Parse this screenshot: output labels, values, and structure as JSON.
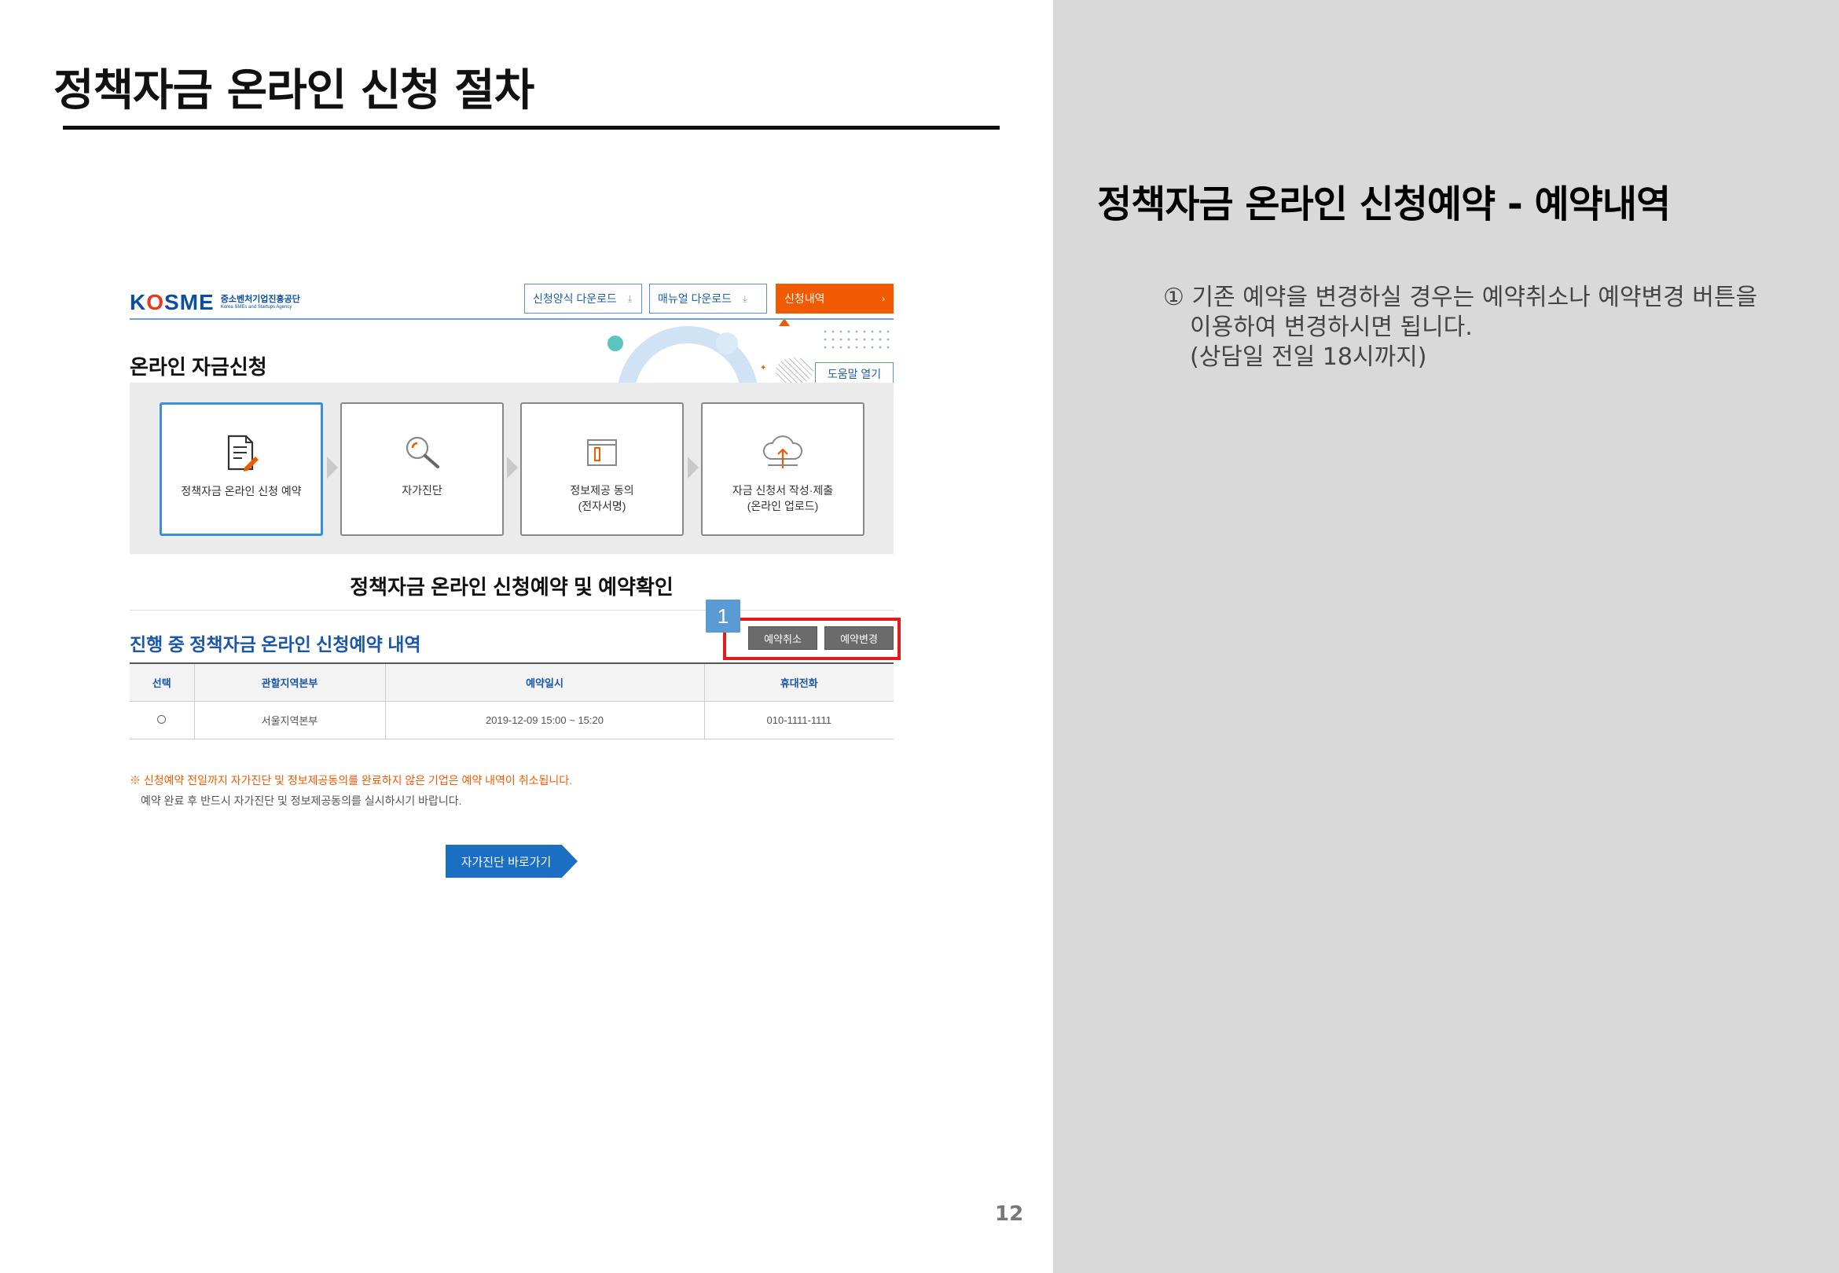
{
  "slide": {
    "title": "정책자금 온라인 신청 절차",
    "page_number": "12"
  },
  "right_panel": {
    "heading": "정책자금 온라인 신청예약 - 예약내역",
    "lines": [
      "① 기존 예약을 변경하실 경우는 예약취소나 예약변경 버튼을",
      "이용하여 변경하시면 됩니다.",
      "(상담일 전일 18시까지)"
    ]
  },
  "screenshot": {
    "logo": {
      "brand": "KOSME",
      "name_ko": "중소벤처기업진흥공단",
      "name_en": "Korea SMEs and Startups Agency"
    },
    "top_buttons": [
      {
        "label": "신청양식 다운로드",
        "icon": "download-icon"
      },
      {
        "label": "매뉴얼 다운로드",
        "icon": "download-icon"
      },
      {
        "label": "신청내역",
        "icon": "chevron-right-icon"
      }
    ],
    "page_title": "온라인 자금신청",
    "help_button": "도움말 열기",
    "steps": [
      {
        "label": "정책자금 온라인 신청 예약",
        "icon": "document-pen-icon",
        "active": true
      },
      {
        "label": "자가진단",
        "icon": "magnifier-icon",
        "active": false
      },
      {
        "label": "정보제공 동의\n(전자서명)",
        "icon": "folder-icon",
        "active": false
      },
      {
        "label": "자금 신청서 작성·제출\n(온라인 업로드)",
        "icon": "cloud-upload-icon",
        "active": false
      }
    ],
    "section_title": "정책자금 온라인 신청예약 및 예약확인",
    "list_title": "진행 중 정책자금 온라인 신청예약 내역",
    "annotation_number": "1",
    "actions": {
      "cancel": "예약취소",
      "change": "예약변경"
    },
    "table": {
      "headers": [
        "선택",
        "관할지역본부",
        "예약일시",
        "휴대전화"
      ],
      "rows": [
        {
          "region": "서울지역본부",
          "datetime": "2019-12-09 15:00 ~ 15:20",
          "phone": "010-1111-1111"
        }
      ]
    },
    "notice_1": "※ 신청예약 전일까지 자가진단 및 정보제공동의를 완료하지 않은 기업은 예약 내역이 취소됩니다.",
    "notice_2": "예약 완료 후 반드시 자가진단 및 정보제공동의를 실시하시기 바랍니다.",
    "go_button": "자가진단 바로가기",
    "colors": {
      "brand_blue": "#1a57a8",
      "accent_orange": "#f15a00",
      "highlight_red": "#e31b1b",
      "badge_blue": "#5b9bd5"
    }
  }
}
